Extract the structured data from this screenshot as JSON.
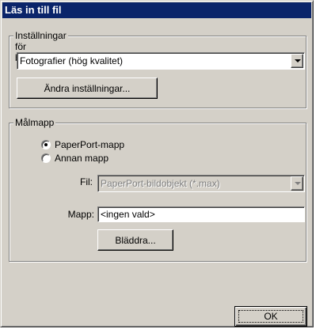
{
  "window": {
    "title": "Läs in till fil"
  },
  "scanner_settings": {
    "legend": "Inställningar för bildläsare",
    "preset_value": "Fotografier (hög kvalitet)",
    "change_button": "Ändra inställningar..."
  },
  "target_folder": {
    "legend": "Målmapp",
    "radio_options": [
      {
        "label": "PaperPort-mapp",
        "selected": true
      },
      {
        "label": "Annan mapp",
        "selected": false
      }
    ],
    "file_label": "Fil:",
    "file_value": "PaperPort-bildobjekt (*.max)",
    "folder_label": "Mapp:",
    "folder_value": "<ingen vald>",
    "browse_button": "Bläddra..."
  },
  "footer": {
    "ok_button": "OK"
  },
  "icons": {
    "dropdown": "chevron-down-icon"
  }
}
